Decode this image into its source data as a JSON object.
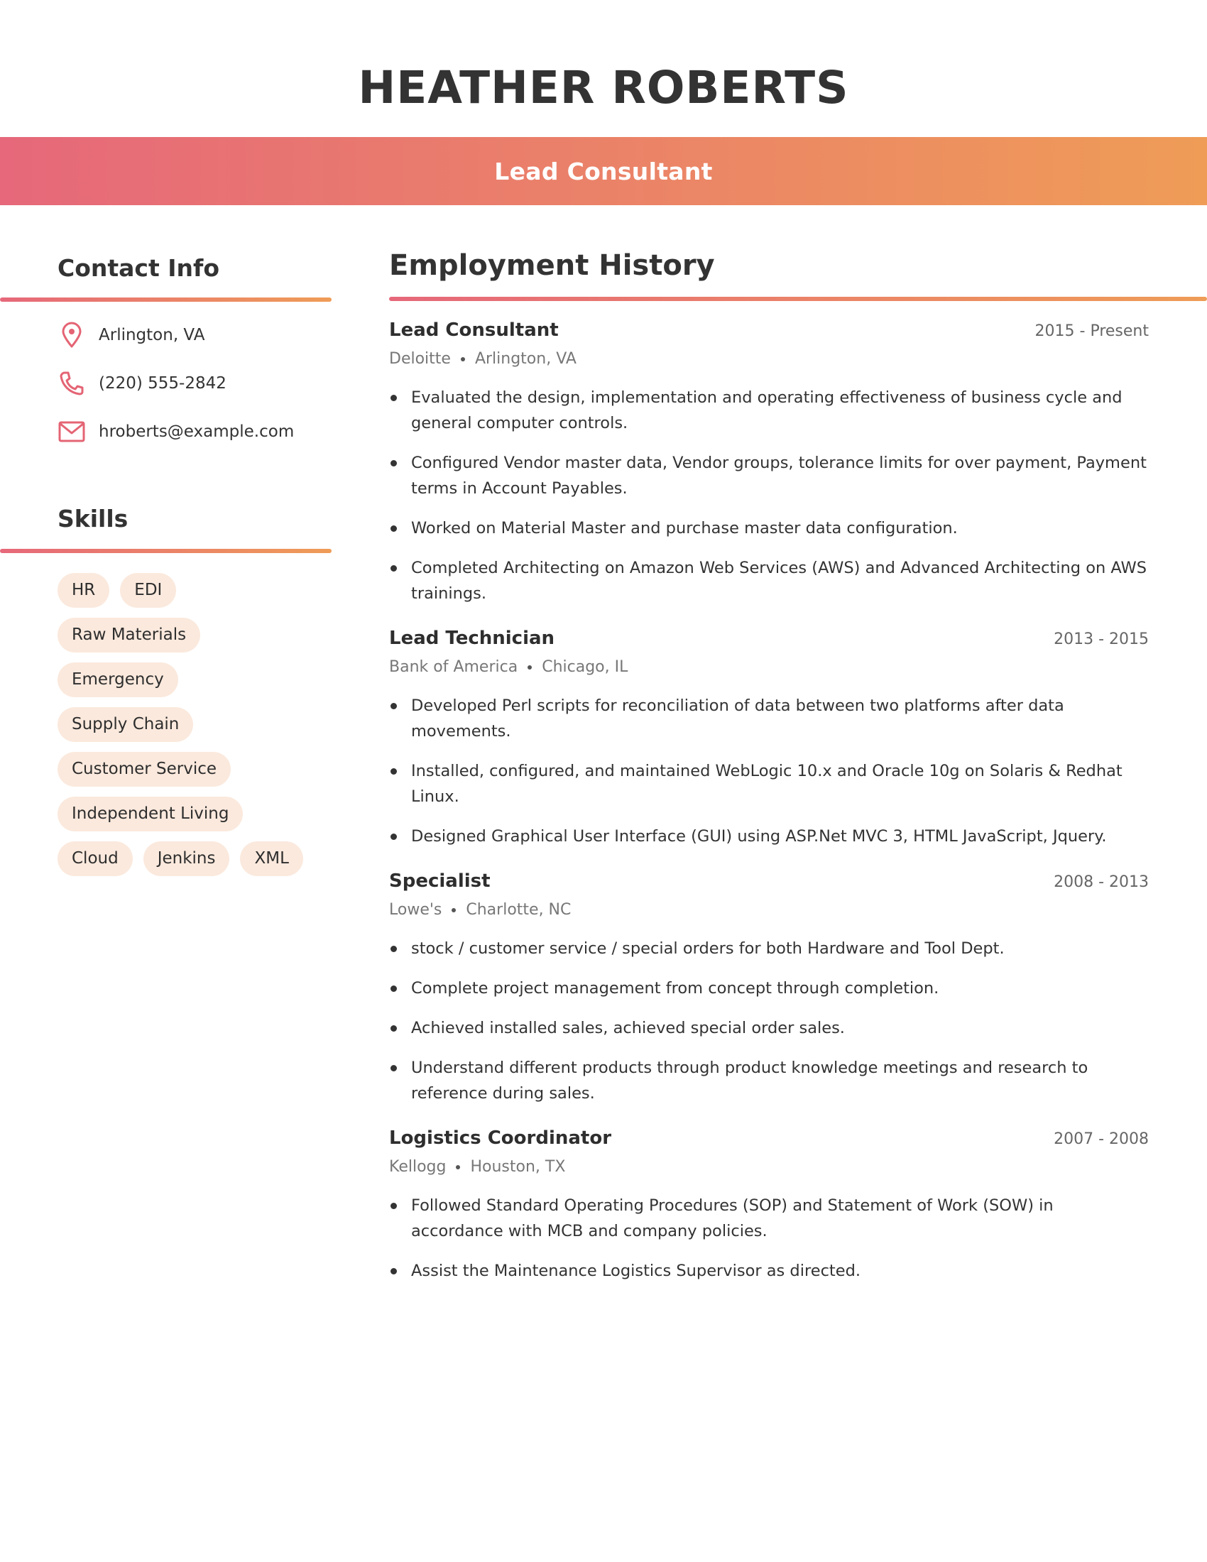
{
  "header": {
    "name": "HEATHER ROBERTS",
    "title": "Lead Consultant"
  },
  "colors": {
    "gradient_start": "#e6687a",
    "gradient_end": "#ef9c57",
    "chip_background": "#fbe9dd",
    "icon": "#e46474"
  },
  "contact": {
    "heading": "Contact Info",
    "items": [
      {
        "icon": "location-pin-icon",
        "text": "Arlington, VA"
      },
      {
        "icon": "phone-icon",
        "text": "(220) 555-2842"
      },
      {
        "icon": "mail-icon",
        "text": "hroberts@example.com"
      }
    ]
  },
  "skills": {
    "heading": "Skills",
    "items": [
      "HR",
      "EDI",
      "Raw Materials",
      "Emergency",
      "Supply Chain",
      "Customer Service",
      "Independent Living",
      "Cloud",
      "Jenkins",
      "XML"
    ]
  },
  "employment": {
    "heading": "Employment History",
    "jobs": [
      {
        "title": "Lead Consultant",
        "dates": "2015 - Present",
        "company": "Deloitte",
        "location": "Arlington, VA",
        "bullets": [
          "Evaluated the design, implementation and operating effectiveness of business cycle and general computer controls.",
          "Configured Vendor master data, Vendor groups, tolerance limits for over payment, Payment terms in Account Payables.",
          "Worked on Material Master and purchase master data configuration.",
          "Completed Architecting on Amazon Web Services (AWS) and Advanced Architecting on AWS trainings."
        ]
      },
      {
        "title": "Lead Technician",
        "dates": "2013 - 2015",
        "company": "Bank of America",
        "location": "Chicago, IL",
        "bullets": [
          "Developed Perl scripts for reconciliation of data between two platforms after data movements.",
          "Installed, configured, and maintained WebLogic 10.x and Oracle 10g on Solaris & Redhat Linux.",
          "Designed Graphical User Interface (GUI) using ASP.Net MVC 3, HTML JavaScript, Jquery."
        ]
      },
      {
        "title": "Specialist",
        "dates": "2008 - 2013",
        "company": "Lowe's",
        "location": "Charlotte, NC",
        "bullets": [
          "stock / customer service / special orders for both Hardware and Tool Dept.",
          "Complete project management from concept through completion.",
          "Achieved installed sales, achieved special order sales.",
          "Understand different products through product knowledge meetings and research to reference during sales."
        ]
      },
      {
        "title": "Logistics Coordinator",
        "dates": "2007 - 2008",
        "company": "Kellogg",
        "location": "Houston, TX",
        "bullets": [
          "Followed Standard Operating Procedures (SOP) and Statement of Work (SOW) in accordance with MCB and company policies.",
          "Assist the Maintenance Logistics Supervisor as directed."
        ]
      }
    ]
  }
}
